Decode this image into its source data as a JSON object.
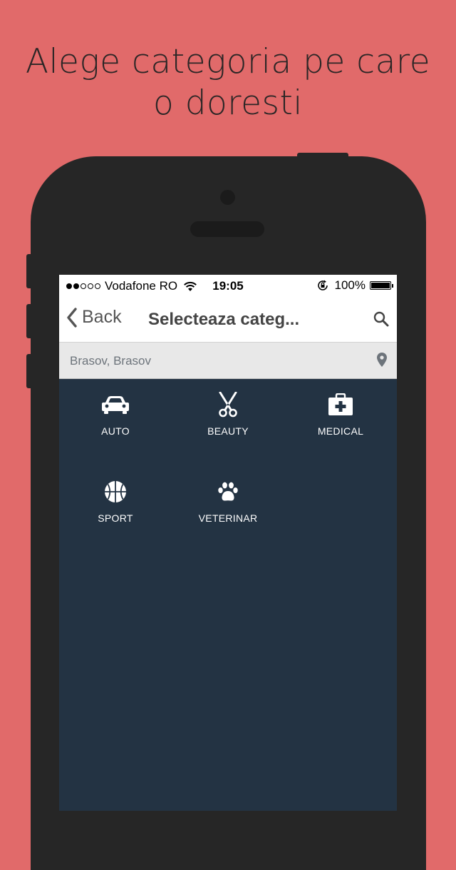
{
  "headline": {
    "line1": "Alege categoria pe care",
    "line2": "o doresti"
  },
  "status_bar": {
    "signal_filled": 2,
    "signal_total": 5,
    "carrier": "Vodafone RO",
    "time": "19:05",
    "battery": "100%",
    "battery_level": 1.0
  },
  "navbar": {
    "back_label": "Back",
    "title": "Selecteaza categ..."
  },
  "location": {
    "text": "Brasov, Brasov"
  },
  "categories": [
    {
      "label": "AUTO",
      "icon": "car-icon"
    },
    {
      "label": "BEAUTY",
      "icon": "scissors-icon"
    },
    {
      "label": "MEDICAL",
      "icon": "first-aid-kit-icon"
    },
    {
      "label": "SPORT",
      "icon": "basketball-icon"
    },
    {
      "label": "VETERINAR",
      "icon": "paw-icon"
    }
  ],
  "colors": {
    "background": "#e16a6a",
    "phone_body": "#262626",
    "screen_bg": "#233343",
    "nav_text": "#444444"
  }
}
